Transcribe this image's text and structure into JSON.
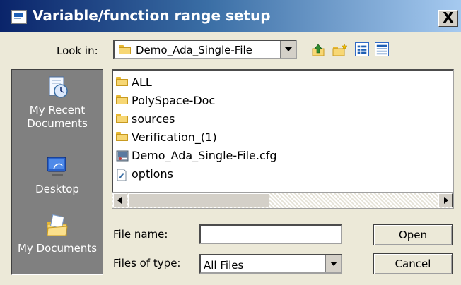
{
  "window": {
    "title": "Variable/function range setup",
    "close_glyph": "X"
  },
  "lookin": {
    "label": "Look in:",
    "value": "Demo_Ada_Single-File",
    "icons": [
      "up-folder-icon",
      "new-folder-icon",
      "list-view-icon",
      "details-view-icon"
    ]
  },
  "places": [
    {
      "label": "My Recent Documents",
      "icon": "recent-documents-icon"
    },
    {
      "label": "Desktop",
      "icon": "desktop-icon"
    },
    {
      "label": "My Documents",
      "icon": "my-documents-icon"
    }
  ],
  "files": [
    {
      "name": "ALL",
      "type": "folder"
    },
    {
      "name": "PolySpace-Doc",
      "type": "folder"
    },
    {
      "name": "sources",
      "type": "folder"
    },
    {
      "name": "Verification_(1)",
      "type": "folder"
    },
    {
      "name": "Demo_Ada_Single-File.cfg",
      "type": "cfg-file"
    },
    {
      "name": "options",
      "type": "file"
    }
  ],
  "filename": {
    "label": "File name:",
    "value": ""
  },
  "filetype": {
    "label": "Files of type:",
    "value": "All Files"
  },
  "buttons": {
    "open": "Open",
    "cancel": "Cancel"
  },
  "colors": {
    "titlebar_start": "#0a246a",
    "titlebar_end": "#a6caf0",
    "dialog_bg": "#ece9d8",
    "places_bg": "#808080"
  }
}
